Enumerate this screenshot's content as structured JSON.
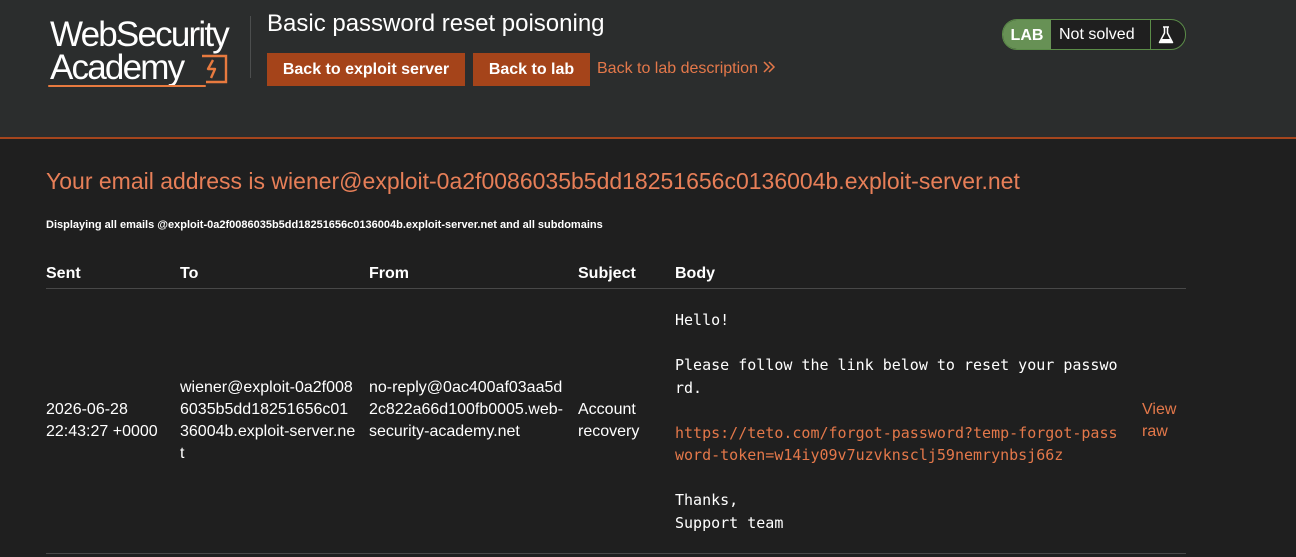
{
  "logo": {
    "line1": "WebSecurity",
    "line2": "Academy"
  },
  "header": {
    "title": "Basic password reset poisoning",
    "back_to_exploit_label": "Back to exploit server",
    "back_to_lab_label": "Back to lab",
    "back_to_description_label": "Back to lab description"
  },
  "status": {
    "badge": "LAB",
    "text": "Not solved"
  },
  "main": {
    "email_heading": "Your email address is wiener@exploit-0a2f0086035b5dd18251656c0136004b.exploit-server.net",
    "subline": "Displaying all emails @exploit-0a2f0086035b5dd18251656c0136004b.exploit-server.net and all subdomains"
  },
  "table": {
    "headers": [
      "Sent",
      "To",
      "From",
      "Subject",
      "Body"
    ],
    "rows": [
      {
        "sent": "2026-06-28 22:43:27 +0000",
        "to": "wiener@exploit-0a2f0086035b5dd18251656c0136004b.exploit-server.net",
        "from": "no-reply@0ac400af03aa5d2c822a66d100fb0005.web-security-academy.net",
        "subject": "Account recovery",
        "body_greeting": "Hello!",
        "body_instruction": "Please follow the link below to reset your password.",
        "body_link": "https://teto.com/forgot-password?temp-forgot-password-token=w14iy09v7uzvknsclj59nemrynbsj66z",
        "body_thanks": "Thanks,",
        "body_signature": "Support team",
        "view_raw_label": "View raw"
      }
    ]
  },
  "colors": {
    "accent": "#e77f58",
    "button": "#a5441a",
    "lab_green": "#679155",
    "background": "#1f1f1f",
    "header_bg": "#2b2d2d"
  }
}
